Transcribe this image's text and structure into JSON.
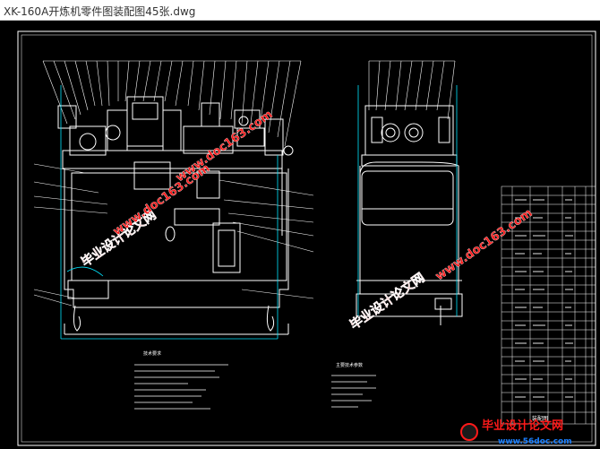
{
  "window": {
    "title": "XK-160A开炼机零件图装配图45张.dwg"
  },
  "drawing": {
    "notes_left_heading": "技术要求",
    "notes_right_heading": "主要技术参数",
    "title_block_label": "装配图"
  },
  "watermarks": {
    "site_cn": "毕业设计论文网",
    "site_url": "www.doc163.com",
    "footer_cn": "毕业设计论文网",
    "footer_url": "www.56doc.com"
  },
  "colors": {
    "background": "#000000",
    "frame": "#ffffff",
    "machine_lines": "#ffffff",
    "leader_lines": "#ffffff",
    "centerlines": "#00e5ff",
    "watermark_red": "#ff1a1a",
    "footer_url_blue": "#1a7fff"
  }
}
